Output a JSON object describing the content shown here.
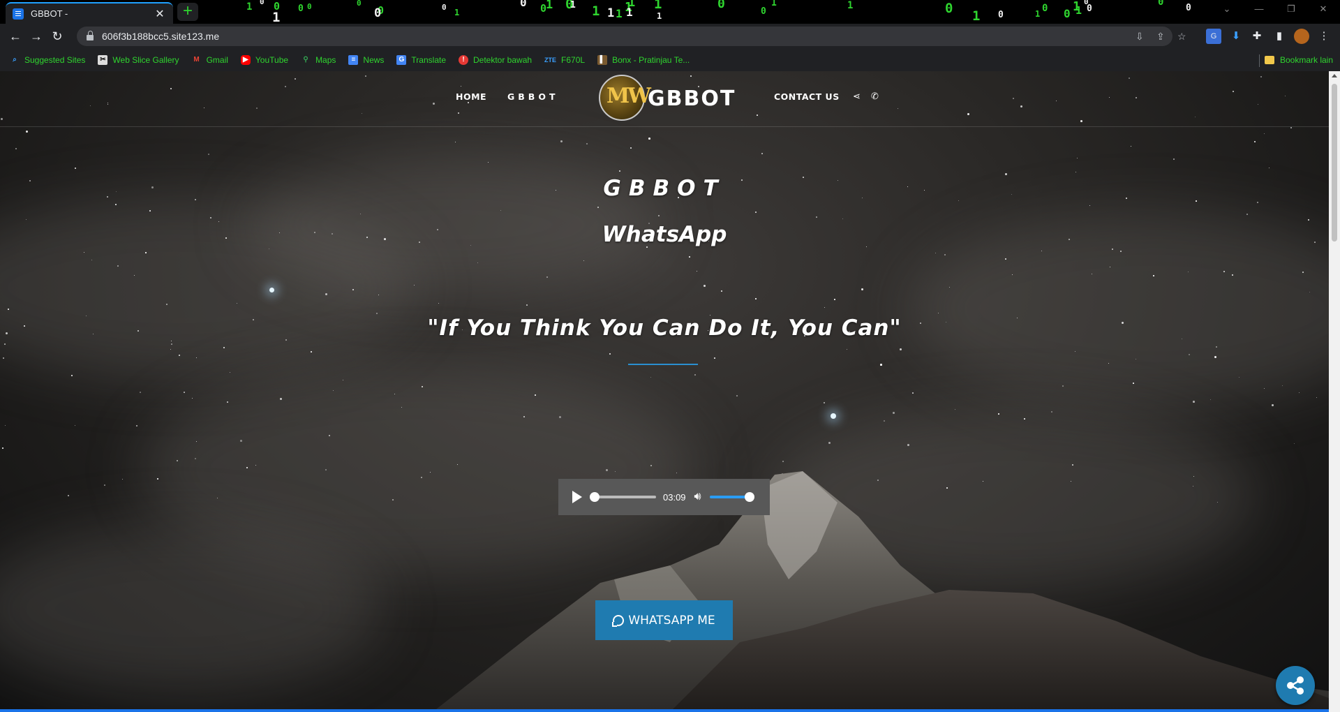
{
  "browser": {
    "tab_title": "GBBOT -",
    "tab_close": "✕",
    "new_tab": "+",
    "url": "606f3b188bcc5.site123.me",
    "matrix_digits": [
      "1",
      "0",
      "1",
      "0",
      "0",
      "1",
      "1",
      "0",
      "0",
      "1",
      "0",
      "0",
      "1",
      "0",
      "1",
      "0",
      "0",
      "1",
      "1",
      "0",
      "1",
      "1",
      "0",
      "1",
      "1",
      "0",
      "0",
      "1",
      "0",
      "1",
      "0",
      "1",
      "0",
      "0",
      "1",
      "0",
      "1",
      "0",
      "0",
      "1"
    ],
    "bookmarks": [
      {
        "label": "Suggested Sites",
        "icon": "search-icon"
      },
      {
        "label": "Web Slice Gallery",
        "icon": "web-slice-icon"
      },
      {
        "label": "Gmail",
        "icon": "gmail-icon"
      },
      {
        "label": "YouTube",
        "icon": "youtube-icon"
      },
      {
        "label": "Maps",
        "icon": "maps-icon"
      },
      {
        "label": "News",
        "icon": "news-icon"
      },
      {
        "label": "Translate",
        "icon": "translate-icon"
      },
      {
        "label": "Detektor bawah",
        "icon": "alert-icon"
      },
      {
        "label": "F670L",
        "icon": "zte-icon",
        "icon_text": "ZTE"
      },
      {
        "label": "Bonx - Pratinjau Te...",
        "icon": "bonx-icon"
      }
    ],
    "other_bookmarks": "Bookmark lain",
    "accent_color": "#2fd52f"
  },
  "site": {
    "nav": {
      "home": "HOME",
      "gbbot": "GBBOT",
      "contact": "CONTACT US"
    },
    "logo": {
      "emblem_text": "MW",
      "text": "GBBOT"
    },
    "hero": {
      "title": "GBBOT",
      "subtitle": "WhatsApp",
      "quote": "\"If You Think You Can Do It, You Can\""
    },
    "audio": {
      "time": "03:09",
      "progress": 0,
      "volume": 1
    },
    "whatsapp_button": "WHATSAPP ME",
    "brand_color": "#1f7bb0"
  }
}
